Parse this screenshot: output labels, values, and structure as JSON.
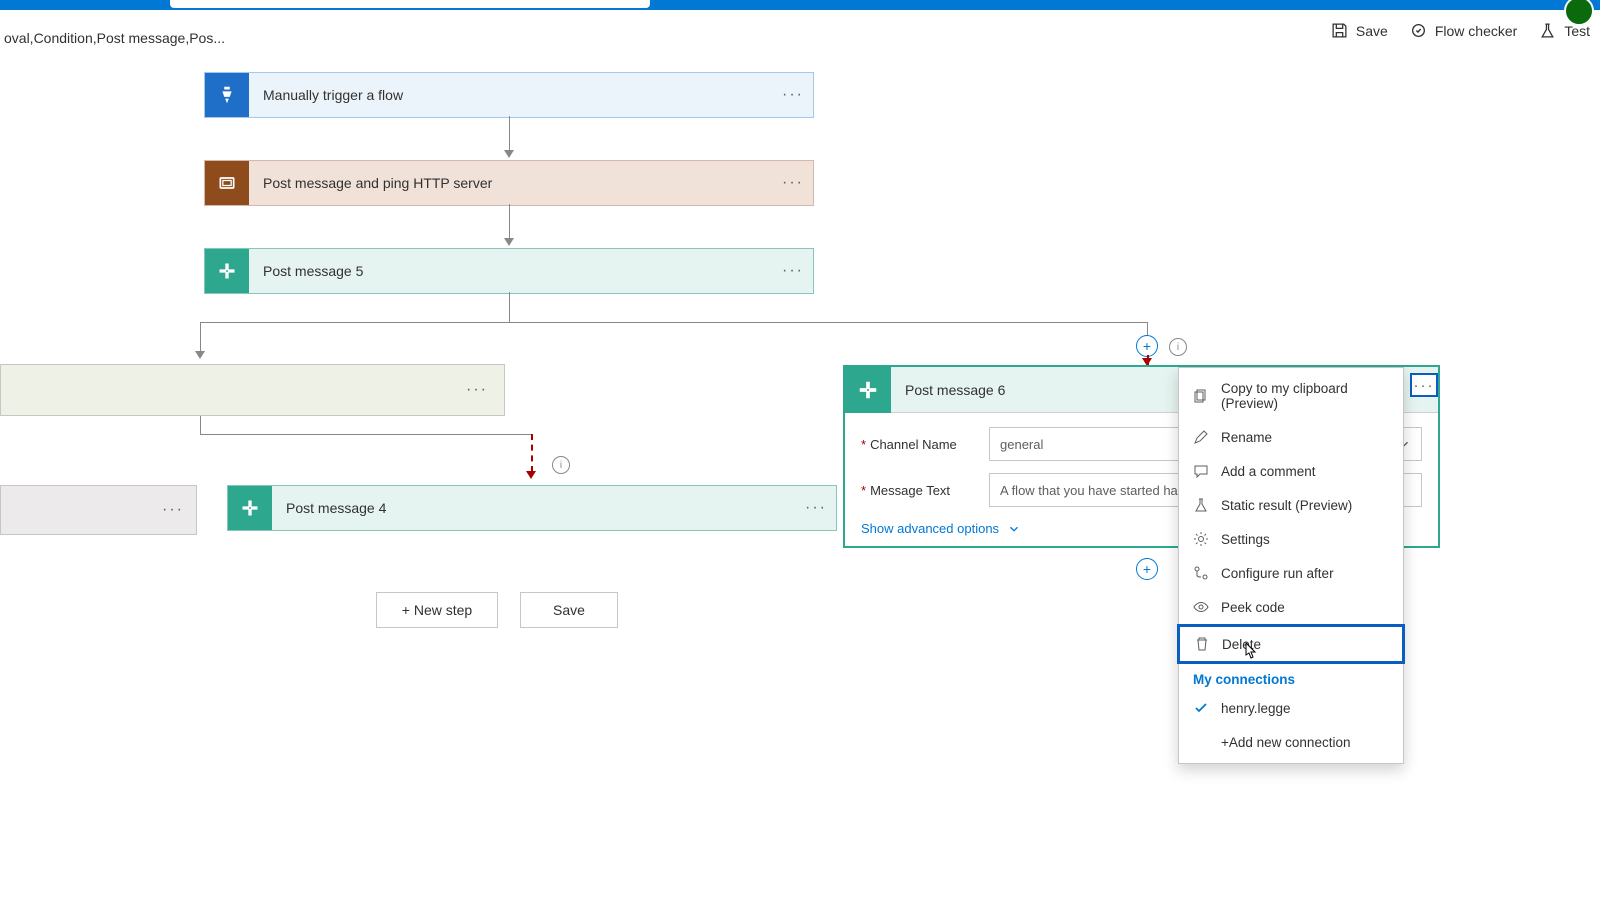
{
  "header": {
    "breadcrumb": "oval,Condition,Post message,Pos...",
    "env": "",
    "toolbar": {
      "save": "Save",
      "flow_checker": "Flow checker",
      "test": "Test"
    }
  },
  "flow": {
    "trigger": "Manually trigger a flow",
    "scope": "Post message and ping HTTP server",
    "post5": "Post message 5",
    "post4": "Post message 4",
    "post6": {
      "title": "Post message 6",
      "fields": {
        "channel_label": "Channel Name",
        "channel_value": "general",
        "message_label": "Message Text",
        "message_value": "A flow that you have started has"
      },
      "advanced": "Show advanced options"
    }
  },
  "buttons": {
    "new_step": "+ New step",
    "save": "Save"
  },
  "menu": {
    "items": {
      "copy": "Copy to my clipboard (Preview)",
      "rename": "Rename",
      "comment": "Add a comment",
      "static": "Static result (Preview)",
      "settings": "Settings",
      "run_after": "Configure run after",
      "peek": "Peek code",
      "delete": "Delete"
    },
    "section": "My connections",
    "connection": "henry.legge",
    "add_conn": "+Add new connection"
  }
}
